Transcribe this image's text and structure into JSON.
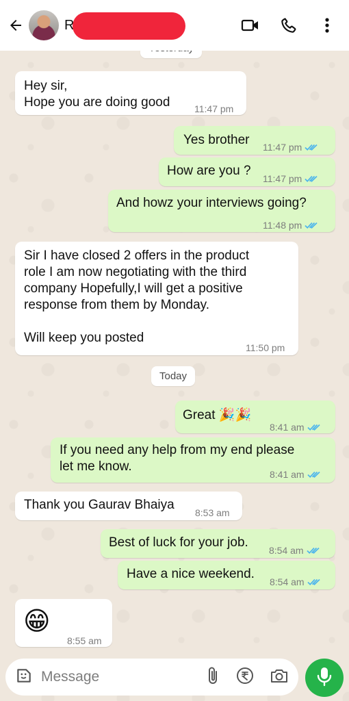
{
  "header": {
    "contact_initial": "R",
    "icons": [
      "back-arrow-icon",
      "video-call-icon",
      "phone-icon",
      "more-vert-icon"
    ]
  },
  "dates": {
    "yesterday": "Yesterday",
    "today": "Today"
  },
  "messages": [
    {
      "dir": "in",
      "text": "Hey sir,\nHope you are doing good",
      "time": "11:47 pm"
    },
    {
      "dir": "out",
      "text": "Yes brother",
      "time": "11:47 pm",
      "status": "read"
    },
    {
      "dir": "out",
      "text": "How are you ?",
      "time": "11:47 pm",
      "status": "read"
    },
    {
      "dir": "out",
      "text": "And howz your interviews going?",
      "time": "11:48 pm",
      "status": "read"
    },
    {
      "dir": "in",
      "text": "Sir I have closed 2 offers in the product\nrole I am now negotiating with the third\ncompany Hopefully,I will get a positive\nresponse from them by Monday.\n\nWill keep you posted",
      "time": "11:50 pm"
    },
    {
      "dir": "out",
      "text": "Great 🎉🎉",
      "time": "8:41 am",
      "status": "read"
    },
    {
      "dir": "out",
      "text": "If you need any help from my end please\nlet me know.",
      "time": "8:41 am",
      "status": "read"
    },
    {
      "dir": "in",
      "text": "Thank you Gaurav Bhaiya",
      "time": "8:53 am"
    },
    {
      "dir": "out",
      "text": "Best of luck for your job.",
      "time": "8:54 am",
      "status": "read"
    },
    {
      "dir": "out",
      "text": "Have a nice weekend.",
      "time": "8:54 am",
      "status": "read"
    },
    {
      "dir": "in",
      "text": "😁",
      "time": "8:55 am"
    }
  ],
  "composer": {
    "placeholder": "Message",
    "icons": [
      "sticker-icon",
      "attach-icon",
      "rupee-payment-icon",
      "camera-icon",
      "mic-icon"
    ]
  },
  "colors": {
    "outgoing_bubble": "#dcf8c6",
    "incoming_bubble": "#ffffff",
    "read_ticks": "#4fb6ec",
    "mic_button": "#25b34a"
  }
}
